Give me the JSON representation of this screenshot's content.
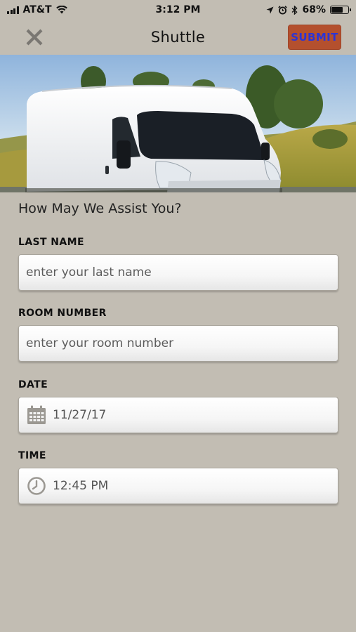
{
  "status": {
    "carrier": "AT&T",
    "time": "3:12 PM",
    "battery_percent": "68%",
    "battery_level": 0.68
  },
  "nav": {
    "title": "Shuttle",
    "submit_label": "SUBMIT",
    "close_icon": "close-icon"
  },
  "colors": {
    "background": "#c2bdb3",
    "submit_bg": "#b4502e",
    "submit_text": "#2c34d6"
  },
  "form": {
    "heading": "How May We Assist You?",
    "last_name": {
      "label": "LAST NAME",
      "placeholder": "enter your last name"
    },
    "room_number": {
      "label": "ROOM NUMBER",
      "placeholder": "enter your room number"
    },
    "date": {
      "label": "DATE",
      "value": "11/27/17",
      "icon": "calendar-icon"
    },
    "time": {
      "label": "TIME",
      "value": "12:45 PM",
      "icon": "clock-icon"
    }
  }
}
